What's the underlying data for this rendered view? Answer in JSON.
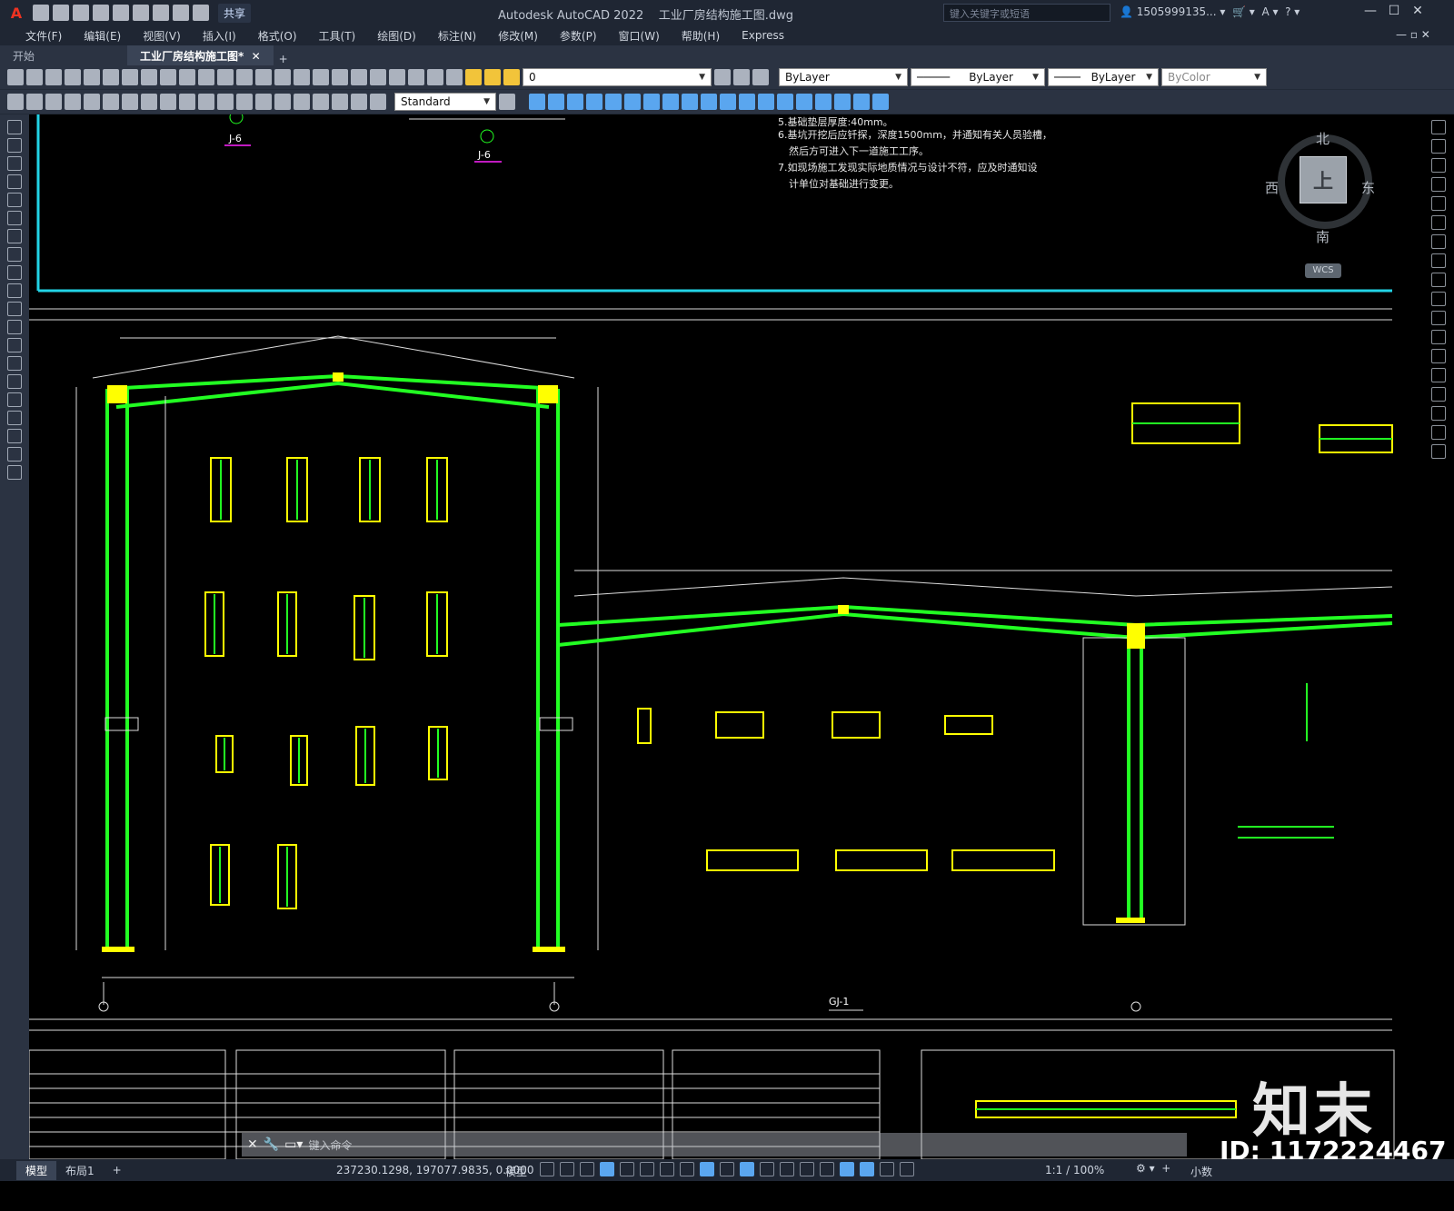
{
  "app": {
    "title": "Autodesk AutoCAD 2022",
    "filename": "工业厂房结构施工图.dwg",
    "share_label": "共享",
    "search_placeholder": "键入关键字或短语",
    "user": "1505999135...",
    "logo": "A"
  },
  "menu": [
    "文件(F)",
    "编辑(E)",
    "视图(V)",
    "插入(I)",
    "格式(O)",
    "工具(T)",
    "绘图(D)",
    "标注(N)",
    "修改(M)",
    "参数(P)",
    "窗口(W)",
    "帮助(H)",
    "Express"
  ],
  "tabs": [
    {
      "label": "开始",
      "active": false
    },
    {
      "label": "工业厂房结构施工图*",
      "active": true
    }
  ],
  "toolbar": {
    "layer": "0",
    "color": "ByLayer",
    "linetype": "ByLayer",
    "lineweight": "ByLayer",
    "plotstyle": "ByColor",
    "text_style": "Standard"
  },
  "viewcube": {
    "north": "北",
    "south": "南",
    "east": "东",
    "west": "西",
    "top": "上",
    "wcs": "WCS"
  },
  "drawing": {
    "notes": [
      "5.基础垫层厚度:40mm。",
      "6.基坑开挖后应钎探，深度1500mm，并通知有关人员验槽，",
      "然后方可进入下一道施工工序。",
      "7.如现场施工发现实际地质情况与设计不符，应及时通知设",
      "计单位对基础进行变更。"
    ],
    "label_j6a": "J-6",
    "label_j6b": "J-6",
    "label_gj1": "GJ-1",
    "accent_green": "#22ff22",
    "accent_yellow": "#ffff00",
    "accent_cyan": "#22d3e6"
  },
  "command": {
    "prompt": "键入命令"
  },
  "status": {
    "model_tab": "模型",
    "layout_tab": "布局1",
    "coords": "237230.1298, 197077.9835, 0.0000",
    "model": "模型",
    "scale": "1:1 / 100%",
    "units": "小数"
  },
  "watermark": {
    "brand": "知末",
    "id": "ID: 1172224467"
  }
}
